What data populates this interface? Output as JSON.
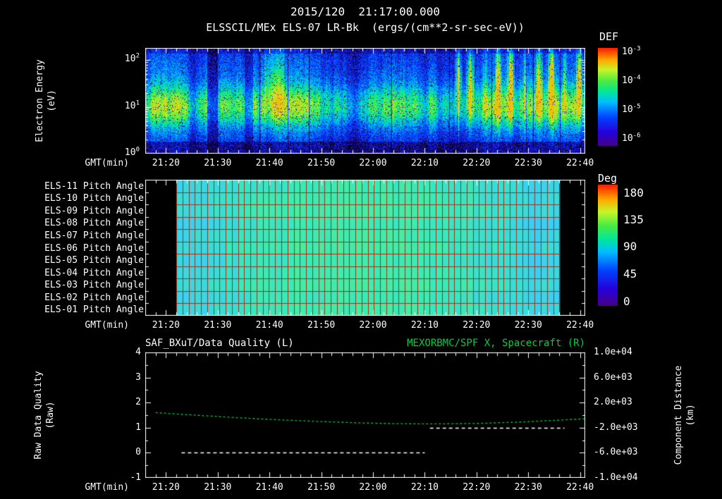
{
  "header": {
    "timestamp": "2015/120  21:17:00.000"
  },
  "labels": {
    "gmt": "GMT(min)",
    "p1_y": [
      "Electron Energy",
      "(eV)"
    ],
    "p3_left": [
      "Raw Data Quality",
      "(Raw)"
    ],
    "p3_right": [
      "Component Distance",
      "(km)"
    ]
  },
  "colors": {
    "background": "#000000",
    "foreground": "#ffffff",
    "accent_green": "#00cc44",
    "grid_red": "#a03219"
  },
  "chart_data": [
    {
      "type": "heatmap",
      "panel": "electron-energy-spectrogram",
      "title": "ELSSCIL/MEx ELS-07 LR-Bk  (ergs/(cm**2-sr-sec-eV))",
      "ylabel": "Electron Energy (eV)",
      "yscale": "log",
      "ylim": [
        "1",
        "180"
      ],
      "yticks": [
        "10^2",
        "10^1",
        "10^0"
      ],
      "xlabel": "GMT(min)",
      "xlim": [
        "21:16",
        "22:41"
      ],
      "xticks": [
        "21:20",
        "21:30",
        "21:40",
        "21:50",
        "22:00",
        "22:10",
        "22:20",
        "22:30",
        "22:40"
      ],
      "colorbar": {
        "label": "DEF",
        "ticks": [
          "10^-3",
          "10^-4",
          "10^-5",
          "10^-6"
        ],
        "colormap": "rainbow",
        "orientation": "vertical"
      },
      "content_summary": "Noisy electron flux spectrogram: persistent cyan-green band near 5-40 eV for the whole interval over a dark blue/black speckled background; intermittent bright green-yellow vertical bursts reaching high energies after about 22:15."
    },
    {
      "type": "heatmap",
      "panel": "pitch-angle-grid",
      "rows": [
        "ELS-11 Pitch Angle",
        "ELS-10 Pitch Angle",
        "ELS-09 Pitch Angle",
        "ELS-08 Pitch Angle",
        "ELS-07 Pitch Angle",
        "ELS-06 Pitch Angle",
        "ELS-05 Pitch Angle",
        "ELS-04 Pitch Angle",
        "ELS-03 Pitch Angle",
        "ELS-02 Pitch Angle",
        "ELS-01 Pitch Angle"
      ],
      "xlabel": "GMT(min)",
      "xlim": [
        "21:16",
        "22:41"
      ],
      "xticks": [
        "21:20",
        "21:30",
        "21:40",
        "21:50",
        "22:00",
        "22:10",
        "22:20",
        "22:30",
        "22:40"
      ],
      "data_start": "21:22",
      "data_end": "22:36",
      "value_range_deg": [
        82,
        108
      ],
      "colorbar": {
        "label": "Deg",
        "ticks": [
          "180",
          "135",
          "90",
          "45",
          "0"
        ],
        "colormap": "rainbow",
        "orientation": "vertical"
      },
      "content_summary": "All eleven ELS anode pitch angles are nearly uniform around 90 degrees (cyan-green cells) drawn as a dark-red lined grid; black outside the data window."
    },
    {
      "type": "line",
      "panel": "quality-and-position",
      "title_left": "SAF_BXuT/Data Quality (L)",
      "title_right": "MEXORBMC/SPF X, Spacecraft (R)",
      "xlabel": "GMT(min)",
      "xlim": [
        "21:16",
        "22:41"
      ],
      "xticks": [
        "21:20",
        "21:30",
        "21:40",
        "21:50",
        "22:00",
        "22:10",
        "22:20",
        "22:30",
        "22:40"
      ],
      "left_axis": {
        "label": "Raw Data Quality (Raw)",
        "ticks": [
          "4",
          "3",
          "2",
          "1",
          "0",
          "-1"
        ],
        "range": [
          -1,
          4
        ]
      },
      "right_axis": {
        "label": "Component Distance (km)",
        "ticks": [
          "1.0e+04",
          "6.0e+03",
          "2.0e+03",
          "-2.0e+03",
          "-6.0e+03",
          "-1.0e+04"
        ],
        "range": [
          -10000,
          10000
        ]
      },
      "series": [
        {
          "name": "MEXORBMC/SPF X Spacecraft",
          "axis": "right",
          "color": "#00cc44",
          "style": "dashed",
          "x": [
            "21:18",
            "21:24",
            "21:32",
            "21:40",
            "21:48",
            "21:56",
            "22:04",
            "22:12",
            "22:20",
            "22:28",
            "22:36",
            "22:41"
          ],
          "y": [
            400,
            80,
            -320,
            -680,
            -960,
            -1200,
            -1360,
            -1400,
            -1320,
            -1120,
            -800,
            -560
          ]
        },
        {
          "name": "SAF_BXuT Data Quality",
          "axis": "left",
          "color": "#ffffff",
          "style": "dashed",
          "segments": [
            {
              "x_start": "21:23",
              "x_end": "22:10",
              "y": 0
            },
            {
              "x_start": "22:11",
              "x_end": "22:37",
              "y": 1
            }
          ]
        }
      ]
    }
  ]
}
